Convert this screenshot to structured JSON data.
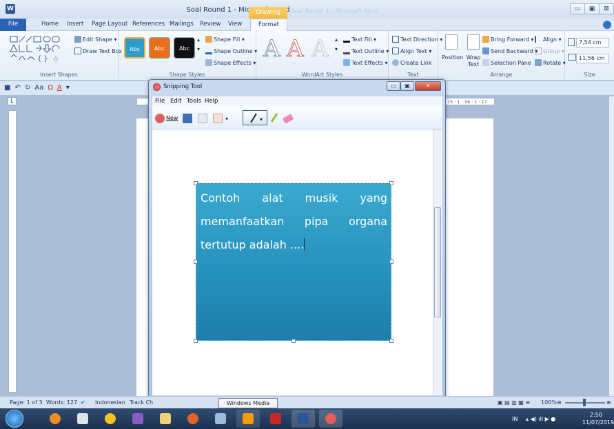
{
  "window": {
    "title": "Soal Round 1 - Microsoft Word",
    "contextual_tab": "Drawing Tools",
    "faded_title": "Soal Round 1 - Microsoft Word",
    "minimize": "▭",
    "restore": "▣",
    "close": "⊠"
  },
  "tabs": [
    "File",
    "Home",
    "Insert",
    "Page Layout",
    "References",
    "Mailings",
    "Review",
    "View",
    "Format"
  ],
  "ribbon": {
    "insert_shapes": {
      "label": "Insert Shapes",
      "edit_shape": "Edit Shape",
      "draw_text_box": "Draw Text Box"
    },
    "shape_styles": {
      "label": "Shape Styles",
      "swatches": [
        {
          "text": "Abc",
          "color": "#2f9cc9"
        },
        {
          "text": "Abc",
          "color": "#e8701d"
        },
        {
          "text": "Abc",
          "color": "#111111"
        }
      ],
      "shape_fill": "Shape Fill",
      "shape_outline": "Shape Outline",
      "shape_effects": "Shape Effects"
    },
    "wordart_styles": {
      "label": "WordArt Styles",
      "text_fill": "Text Fill",
      "text_outline": "Text Outline",
      "text_effects": "Text Effects"
    },
    "text": {
      "label": "Text",
      "text_direction": "Text Direction",
      "align_text": "Align Text",
      "create_link": "Create Link"
    },
    "arrange": {
      "label": "Arrange",
      "position": "Position",
      "wrap_text": "Wrap Text",
      "bring_forward": "Bring Forward",
      "send_backward": "Send Backward",
      "selection_pane": "Selection Pane",
      "align": "Align",
      "group": "Group",
      "rotate": "Rotate"
    },
    "size": {
      "label": "Size",
      "height": "7,54 cm",
      "width": "11,56 cm"
    }
  },
  "ruler": {
    "ticks": "15 · 1 · 16 · 1 · 17"
  },
  "status_bar": {
    "page": "Page: 1 of 3",
    "words": "Words: 127",
    "language": "Indonesian",
    "track": "Track Ch",
    "zoom": "100%"
  },
  "snipping_tool": {
    "title": "Snipping Tool",
    "menu": [
      "File",
      "Edit",
      "Tools",
      "Help"
    ],
    "new_label": "New"
  },
  "textbox": {
    "text": "Contoh alat musik yang memanfaatkan pipa organa tertutup adalah ...."
  },
  "tooltip": "Windows Media Player",
  "clock": {
    "time": "2:50",
    "date": "11/07/2019",
    "lang": "IN"
  }
}
